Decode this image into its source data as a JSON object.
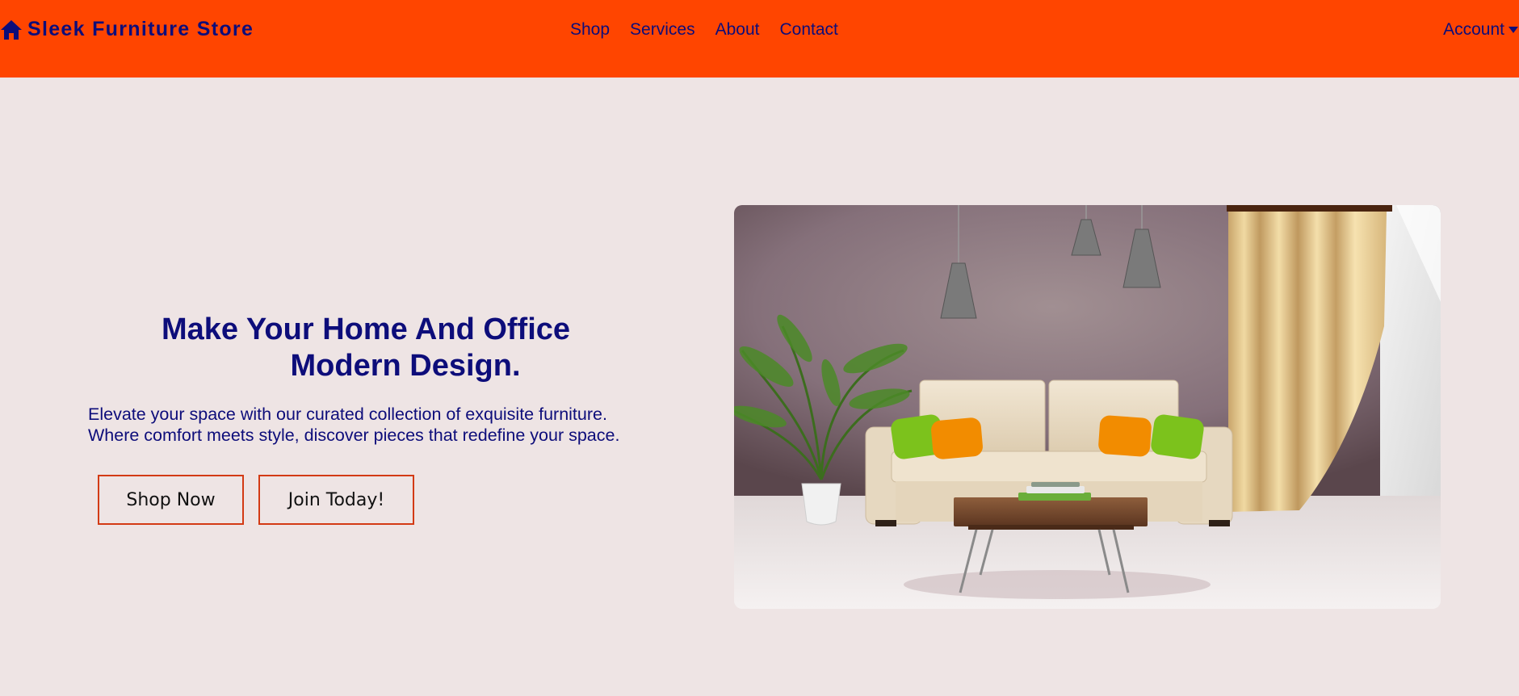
{
  "header": {
    "brand": "Sleek Furniture Store",
    "brand_icon": "home-icon",
    "nav": {
      "shop": "Shop",
      "services": "Services",
      "about": "About",
      "contact": "Contact"
    },
    "account": "Account",
    "account_icon": "caret-down-icon"
  },
  "hero": {
    "title_line1": "Make Your Home And Office",
    "title_line2": "Modern Design.",
    "desc_line1": "Elevate your space with our curated collection of exquisite furniture.",
    "desc_line2": "Where comfort meets style, discover pieces that redefine your space.",
    "btn_shop": "Shop Now",
    "btn_join": "Join Today!"
  },
  "colors": {
    "header_bg": "#FF4500",
    "page_bg": "#EEE4E4",
    "text": "#0D0D7A",
    "button_border": "#D33A14"
  }
}
